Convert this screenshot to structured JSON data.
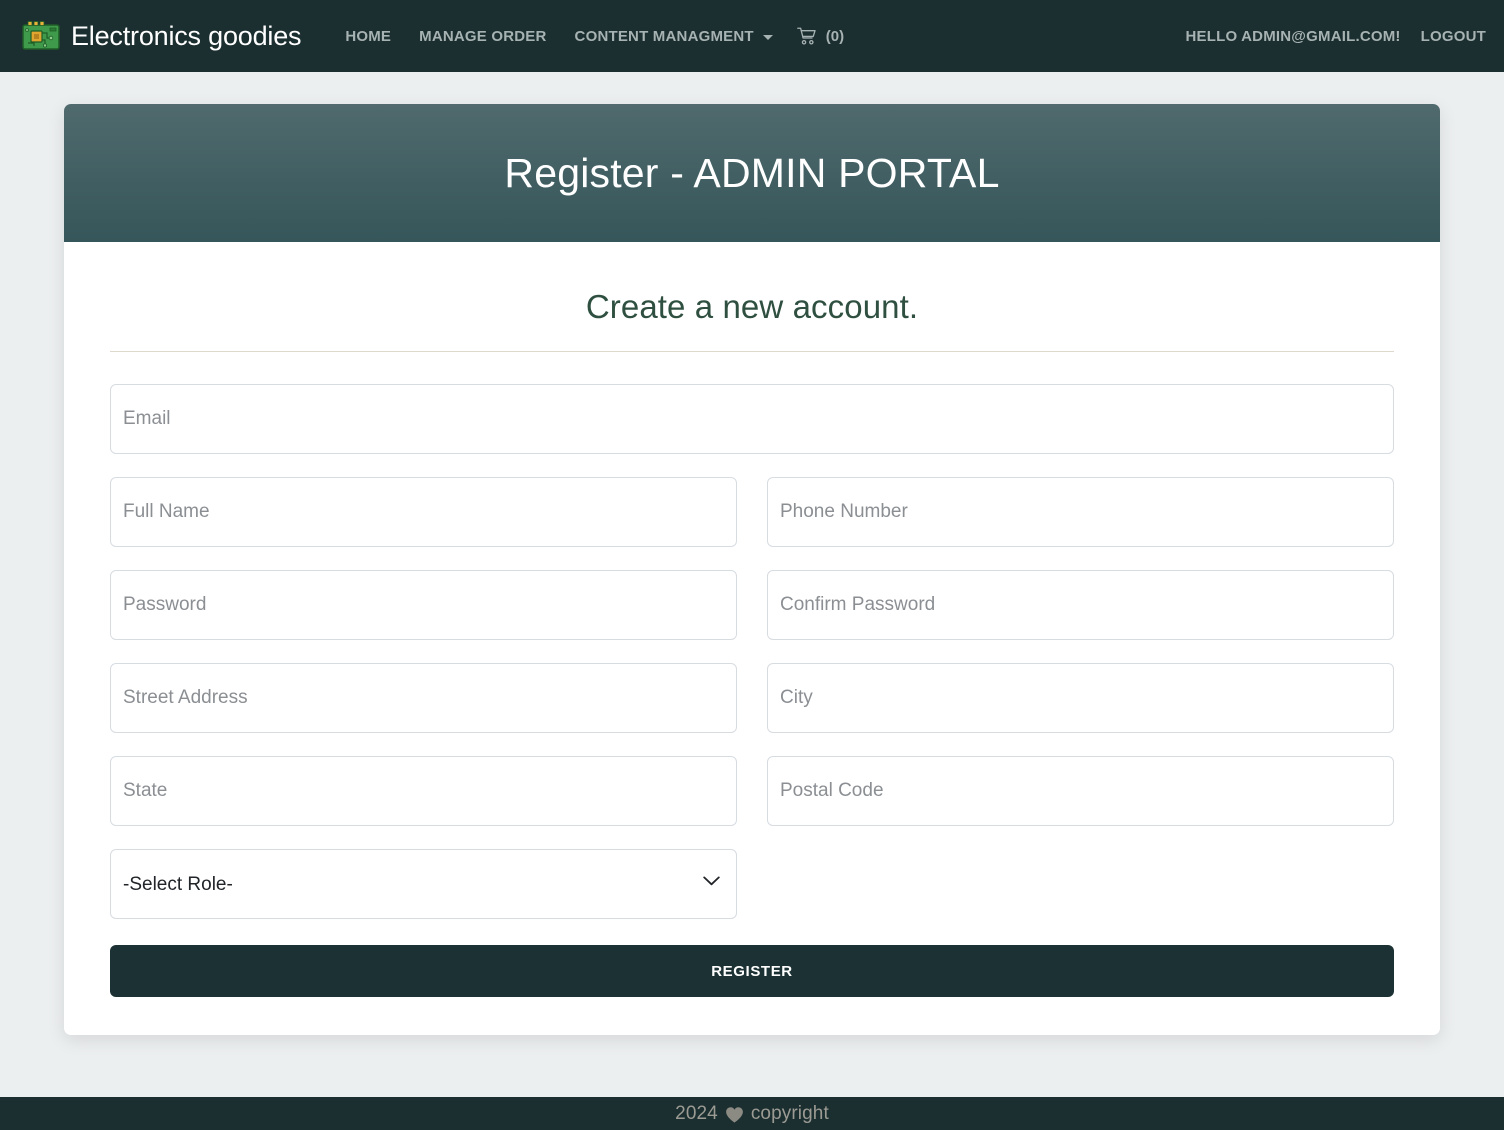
{
  "navbar": {
    "brand": "Electronics goodies",
    "brand_logo_icon": "circuit-board-chip-icon",
    "links": [
      {
        "label": "HOME",
        "icon": null
      },
      {
        "label": "MANAGE ORDER",
        "icon": null
      },
      {
        "label": "CONTENT MANAGMENT",
        "icon": "chevron-down-icon"
      }
    ],
    "cart": {
      "icon": "shopping-cart-icon",
      "count_label": "(0)"
    },
    "greeting": "HELLO ADMIN@GMAIL.COM!",
    "logout": "LOGOUT",
    "background_color": "#1b2e30",
    "link_color": "#a7b2b2"
  },
  "card": {
    "header_title": "Register - ADMIN PORTAL",
    "header_gradient_from": "#506a6d",
    "header_gradient_to": "#35565a",
    "subtitle": "Create a new account."
  },
  "form": {
    "fields": [
      {
        "name": "email",
        "placeholder": "Email",
        "value": "",
        "type": "email",
        "span": "full"
      },
      {
        "name": "full-name",
        "placeholder": "Full Name",
        "value": "",
        "type": "text",
        "span": "half"
      },
      {
        "name": "phone-number",
        "placeholder": "Phone Number",
        "value": "",
        "type": "text",
        "span": "half"
      },
      {
        "name": "password",
        "placeholder": "Password",
        "value": "",
        "type": "password",
        "span": "half"
      },
      {
        "name": "confirm-password",
        "placeholder": "Confirm Password",
        "value": "",
        "type": "password",
        "span": "half"
      },
      {
        "name": "street-address",
        "placeholder": "Street Address",
        "value": "",
        "type": "text",
        "span": "half"
      },
      {
        "name": "city",
        "placeholder": "City",
        "value": "",
        "type": "text",
        "span": "half"
      },
      {
        "name": "state",
        "placeholder": "State",
        "value": "",
        "type": "text",
        "span": "half"
      },
      {
        "name": "postal-code",
        "placeholder": "Postal Code",
        "value": "",
        "type": "text",
        "span": "half"
      }
    ],
    "role_select": {
      "selected": "-Select Role-",
      "options": [
        "-Select Role-"
      ],
      "chevron_icon": "chevron-down-icon"
    },
    "submit_label": "REGISTER",
    "submit_color": "#1c3134"
  },
  "footer": {
    "year": "2024",
    "heart_icon": "heart-icon",
    "text": "copyright",
    "background_color": "#1b2e30"
  },
  "page": {
    "background_color": "#eceff0"
  }
}
